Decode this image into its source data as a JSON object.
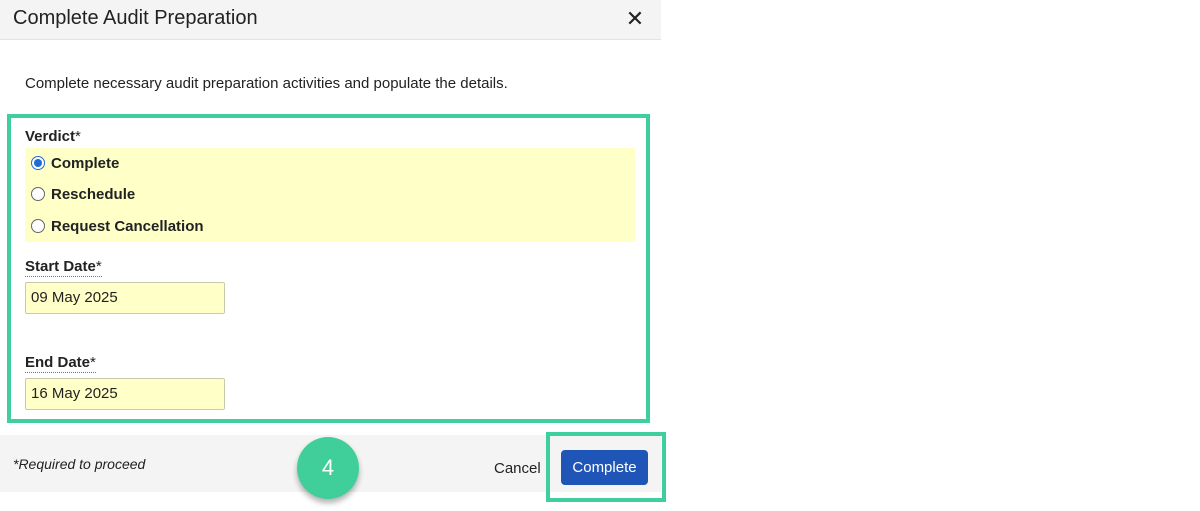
{
  "dialog": {
    "title": "Complete Audit Preparation",
    "close_symbol": "✕",
    "description": "Complete necessary audit preparation activities and populate the details."
  },
  "form": {
    "verdict_label": "Verdict",
    "required_mark": "*",
    "verdict_options": [
      {
        "label": "Complete",
        "selected": true
      },
      {
        "label": "Reschedule",
        "selected": false
      },
      {
        "label": "Request Cancellation",
        "selected": false
      }
    ],
    "start_date_label": "Start Date",
    "start_date_value": "09 May 2025",
    "end_date_label": "End Date",
    "end_date_value": "16 May 2025"
  },
  "footer": {
    "required_note": "*Required to proceed",
    "cancel_label": "Cancel",
    "complete_label": "Complete"
  },
  "annotation": {
    "step_number": "4"
  },
  "colors": {
    "highlight_border": "#3fcf9e",
    "field_background": "#ffffc8",
    "primary_button": "#1f55b7",
    "step_badge": "#40cf9b"
  },
  "icons": {
    "close": "close-icon"
  }
}
